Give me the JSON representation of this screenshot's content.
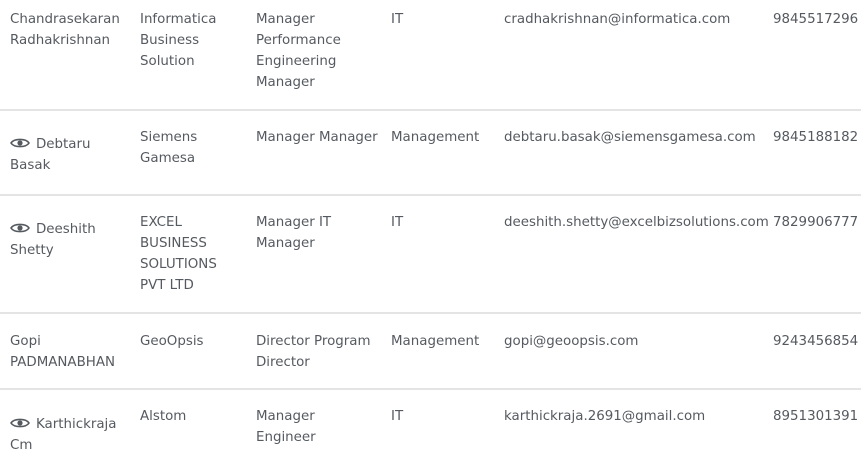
{
  "contacts": [
    {
      "has_view_icon": false,
      "name_line1": "Chandrasekaran",
      "name_line2": "Radhakrishnan",
      "company": "Informatica Business Solution",
      "title": "Manager Performance Engineering Manager",
      "department": "IT",
      "email": "cradhakrishnan@informatica.com",
      "phone": "9845517296"
    },
    {
      "has_view_icon": true,
      "name_line1": "Debtaru",
      "name_line2": "Basak",
      "company": "Siemens Gamesa",
      "title": "Manager Manager",
      "department": "Management",
      "email": "debtaru.basak@siemensgamesa.com",
      "phone": "9845188182"
    },
    {
      "has_view_icon": true,
      "name_line1": "Deeshith",
      "name_line2": "Shetty",
      "company": "EXCEL BUSINESS SOLUTIONS PVT LTD",
      "title": "Manager IT Manager",
      "department": "IT",
      "email": "deeshith.shetty@excelbizsolutions.com",
      "phone": "7829906777"
    },
    {
      "has_view_icon": false,
      "name_line1": "Gopi",
      "name_line2": "PADMANABHAN",
      "company": "GeoOpsis",
      "title": "Director Program Director",
      "department": "Management",
      "email": "gopi@geoopsis.com",
      "phone": "9243456854"
    },
    {
      "has_view_icon": true,
      "name_line1": "Karthickraja",
      "name_line2": "Cm",
      "company": "Alstom",
      "title": "Manager Engineer",
      "department": "IT",
      "email": "karthickraja.2691@gmail.com",
      "phone": "8951301391"
    }
  ],
  "icons": {
    "view": "eye-icon"
  },
  "colors": {
    "text": "#555a60",
    "divider": "#e4e4e4"
  }
}
